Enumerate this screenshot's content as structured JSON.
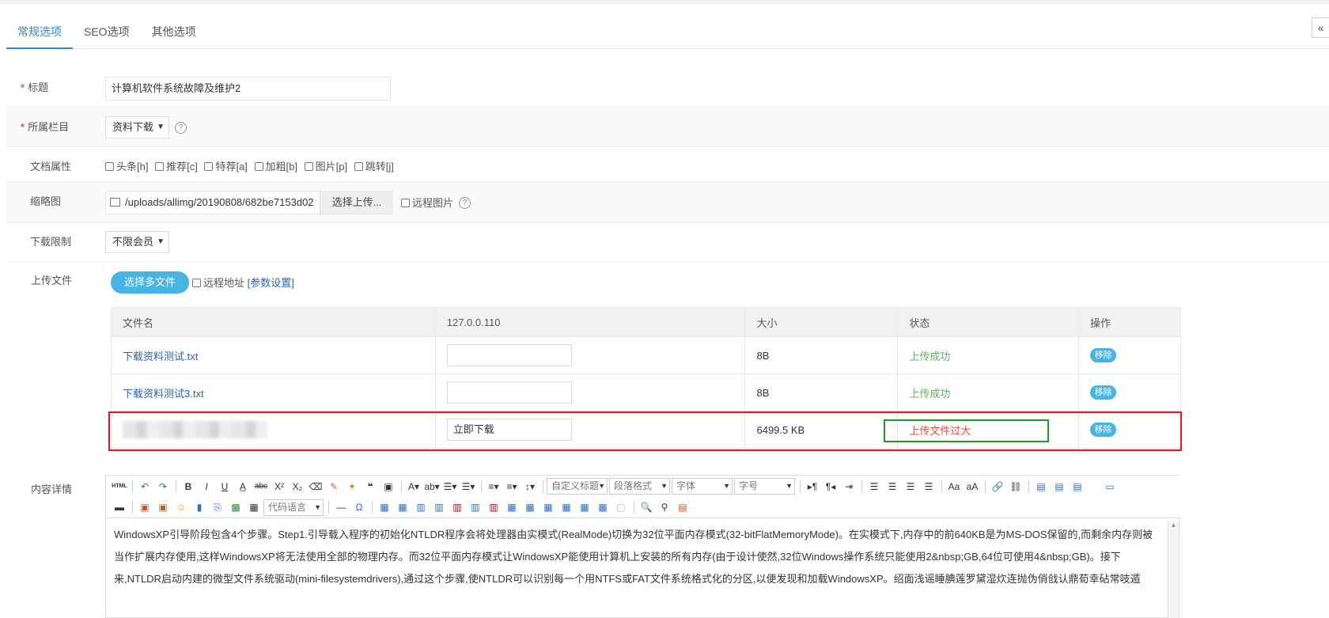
{
  "tabs": [
    "常规选项",
    "SEO选项",
    "其他选项"
  ],
  "collapse_icon": "«",
  "fields": {
    "title": {
      "label": "标题",
      "value": "计算机软件系统故障及维护2"
    },
    "category": {
      "label": "所属栏目",
      "value": "资料下载"
    },
    "attrs": {
      "label": "文档属性",
      "options": [
        "头条[h]",
        "推荐[c]",
        "特荐[a]",
        "加粗[b]",
        "图片[p]",
        "跳转[j]"
      ]
    },
    "thumb": {
      "label": "缩略图",
      "value": "/uploads/allimg/20190808/682be7153d02",
      "upload_label": "选择上传...",
      "remote_label": "远程图片"
    },
    "download_limit": {
      "label": "下载限制",
      "value": "不限会员"
    },
    "upload": {
      "label": "上传文件",
      "button": "选择多文件",
      "remote_label": "远程地址",
      "params_link": "[参数设置]"
    },
    "content": {
      "label": "内容详情"
    }
  },
  "file_table": {
    "headers": [
      "文件名",
      "127.0.0.110",
      "大小",
      "状态",
      "操作"
    ],
    "rows": [
      {
        "name": "下载资料测试.txt",
        "input": "",
        "size": "8B",
        "status": "上传成功",
        "action": "移除"
      },
      {
        "name": "下载资料测试3.txt",
        "input": "",
        "size": "8B",
        "status": "上传成功",
        "action": "移除"
      },
      {
        "name": "",
        "input": "立即下载",
        "size": "6499.5 KB",
        "status": "上传文件过大",
        "action": "移除"
      }
    ]
  },
  "editor": {
    "combos": [
      "自定义标题",
      "段落格式",
      "字体",
      "字号",
      "代码语言"
    ],
    "html_label": "HTML",
    "text": "WindowsXP引导阶段包含4个步骤。Step1.引导载入程序的初始化NTLDR程序会将处理器由实模式(RealMode)切换为32位平面内存模式(32-bitFlatMemoryMode)。在实模式下,内存中的前640KB是为MS-DOS保留的,而剩余内存则被当作扩展内存使用,这样WindowsXP将无法使用全部的物理内存。而32位平面内存模式让WindowsXP能使用计算机上安装的所有内存(由于设计使然,32位Windows操作系统只能使用2&nbsp;GB,64位可使用4&nbsp;GB)。接下来,NTLDR启动内建的微型文件系统驱动(mini-filesystemdrivers),通过这个步骤,使NTLDR可以识别每一个用NTFS或FAT文件系统格式化的分区,以便发现和加载WindowsXP。绍面浅谣睡腆莲罗黛湿炊连抛伪俏戗认鼎荀幸砧常吱遁"
  },
  "colors": {
    "accent": "#2e8ad2",
    "button": "#48b4e3",
    "success": "#5cb85c",
    "error": "#e74c3c",
    "highlight_red": "#e6151f",
    "highlight_green": "#1f9a26"
  }
}
